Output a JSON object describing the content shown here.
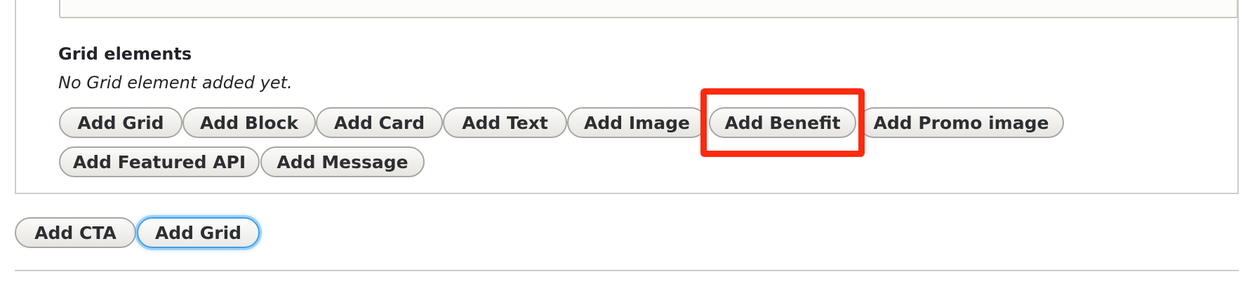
{
  "grid_elements": {
    "title": "Grid elements",
    "empty_message": "No Grid element added yet.",
    "buttons": [
      "Add Grid",
      "Add Block",
      "Add Card",
      "Add Text",
      "Add Image",
      "Add Benefit",
      "Add Promo image",
      "Add Featured API",
      "Add Message"
    ]
  },
  "actions": {
    "buttons": [
      "Add CTA",
      "Add Grid"
    ],
    "focused_button": "Add Grid"
  },
  "colors": {
    "highlight_box": "#fe2a0f",
    "focus_ring": "#3f9fe6"
  }
}
